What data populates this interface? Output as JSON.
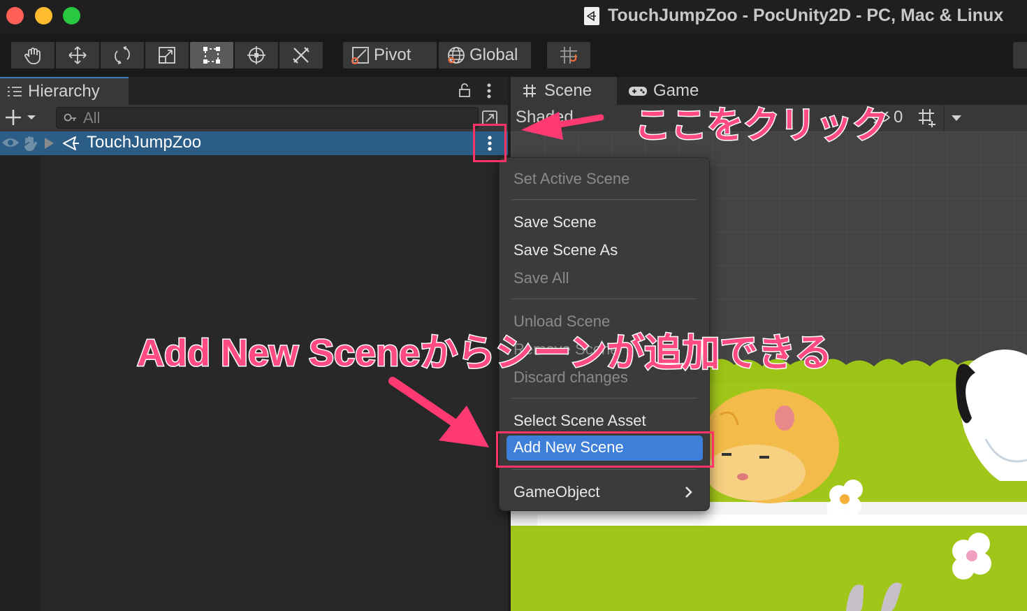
{
  "window": {
    "title": "TouchJumpZoo - PocUnity2D - PC, Mac & Linux"
  },
  "toolbar": {
    "tools": [
      "hand-tool",
      "move-tool",
      "rotate-tool",
      "scale-tool",
      "rect-tool",
      "transform-tool",
      "custom-tool"
    ],
    "active_tool": "rect-tool",
    "pivot_label": "Pivot",
    "global_label": "Global"
  },
  "hierarchy": {
    "tab_label": "Hierarchy",
    "search_placeholder": "All",
    "scene_name": "TouchJumpZoo"
  },
  "scene_view": {
    "scene_tab_label": "Scene",
    "game_tab_label": "Game",
    "shading_mode": "Shaded",
    "hidden_count": "0"
  },
  "context_menu": {
    "items": [
      {
        "label": "Set Active Scene",
        "enabled": false
      },
      {
        "label": "Save Scene",
        "enabled": true
      },
      {
        "label": "Save Scene As",
        "enabled": true
      },
      {
        "label": "Save All",
        "enabled": false
      },
      {
        "label": "Unload Scene",
        "enabled": false
      },
      {
        "label": "Remove Scene",
        "enabled": false
      },
      {
        "label": "Discard changes",
        "enabled": false
      },
      {
        "label": "Select Scene Asset",
        "enabled": true
      },
      {
        "label": "Add New Scene",
        "enabled": true,
        "highlighted": true
      },
      {
        "label": "GameObject",
        "enabled": true,
        "submenu": true
      }
    ]
  },
  "annotations": {
    "click_here": "ここをクリック",
    "add_new_scene_note": "Add New Sceneからシーンが追加できる",
    "color": "#ff3366"
  },
  "colors": {
    "selection": "#2c5d87",
    "menu_highlight": "#3d7fd9",
    "annotation": "#ff3366"
  }
}
